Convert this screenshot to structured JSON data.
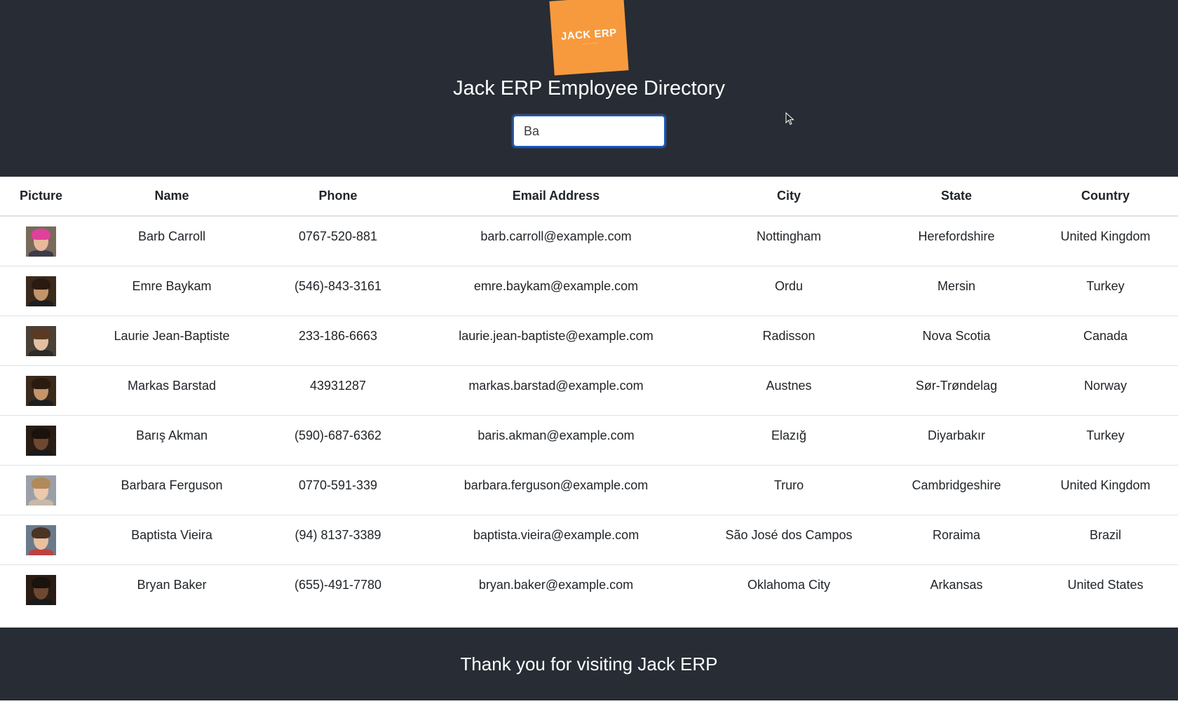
{
  "header": {
    "logo_text": "JACK ERP",
    "title": "Jack ERP Employee Directory",
    "search_value": "Ba",
    "colors": {
      "background": "#282c34",
      "logo": "#f79a3e"
    }
  },
  "table": {
    "columns": [
      "Picture",
      "Name",
      "Phone",
      "Email Address",
      "City",
      "State",
      "Country"
    ],
    "rows": [
      {
        "name": "Barb Carroll",
        "phone": "0767-520-881",
        "email": "barb.carroll@example.com",
        "city": "Nottingham",
        "state": "Herefordshire",
        "country": "United Kingdom"
      },
      {
        "name": "Emre Baykam",
        "phone": "(546)-843-3161",
        "email": "emre.baykam@example.com",
        "city": "Ordu",
        "state": "Mersin",
        "country": "Turkey"
      },
      {
        "name": "Laurie Jean-Baptiste",
        "phone": "233-186-6663",
        "email": "laurie.jean-baptiste@example.com",
        "city": "Radisson",
        "state": "Nova Scotia",
        "country": "Canada"
      },
      {
        "name": "Markas Barstad",
        "phone": "43931287",
        "email": "markas.barstad@example.com",
        "city": "Austnes",
        "state": "Sør-Trøndelag",
        "country": "Norway"
      },
      {
        "name": "Barış Akman",
        "phone": "(590)-687-6362",
        "email": "baris.akman@example.com",
        "city": "Elazığ",
        "state": "Diyarbakır",
        "country": "Turkey"
      },
      {
        "name": "Barbara Ferguson",
        "phone": "0770-591-339",
        "email": "barbara.ferguson@example.com",
        "city": "Truro",
        "state": "Cambridgeshire",
        "country": "United Kingdom"
      },
      {
        "name": "Baptista Vieira",
        "phone": "(94) 8137-3389",
        "email": "baptista.vieira@example.com",
        "city": "São José dos Campos",
        "state": "Roraima",
        "country": "Brazil"
      },
      {
        "name": "Bryan Baker",
        "phone": "(655)-491-7780",
        "email": "bryan.baker@example.com",
        "city": "Oklahoma City",
        "state": "Arkansas",
        "country": "United States"
      }
    ]
  },
  "footer": {
    "text": "Thank you for visiting Jack ERP"
  }
}
